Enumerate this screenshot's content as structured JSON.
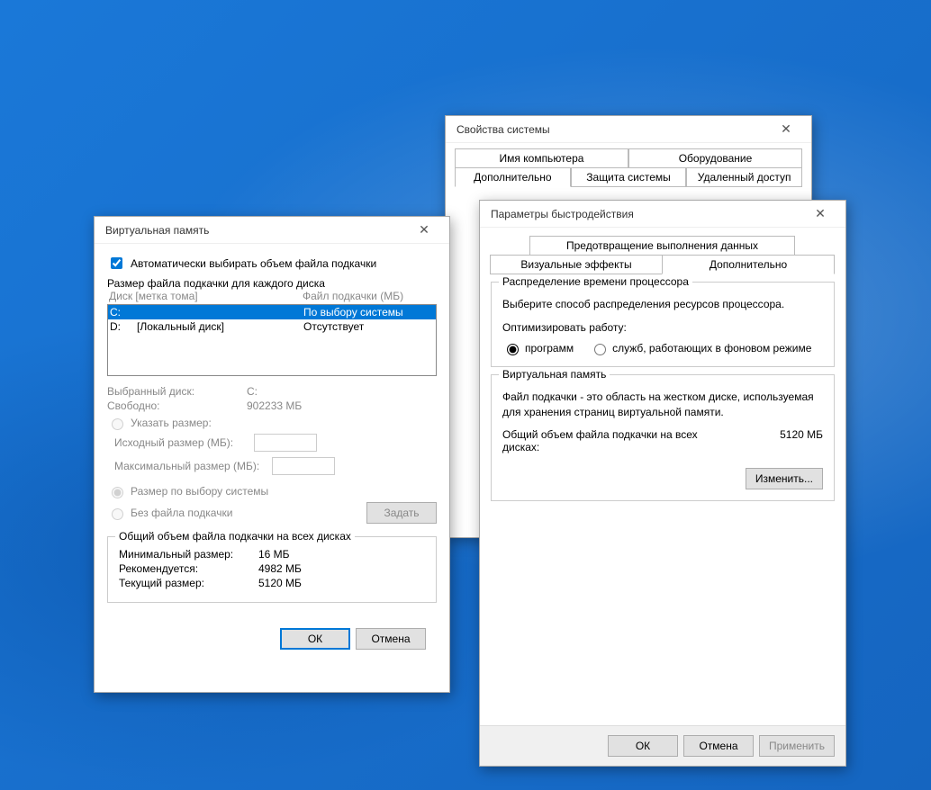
{
  "sys": {
    "title": "Свойства системы",
    "tabs": {
      "name": "Имя компьютера",
      "hardware": "Оборудование",
      "advanced": "Дополнительно",
      "protection": "Защита системы",
      "remote": "Удаленный доступ"
    }
  },
  "perf": {
    "title": "Параметры быстродействия",
    "tabs": {
      "dep": "Предотвращение выполнения данных",
      "visual": "Визуальные эффекты",
      "advanced": "Дополнительно"
    },
    "cpu": {
      "legend": "Распределение времени процессора",
      "desc": "Выберите способ распределения ресурсов процессора.",
      "optimize": "Оптимизировать работу:",
      "programs": "программ",
      "services": "служб, работающих в фоновом режиме"
    },
    "vm": {
      "legend": "Виртуальная память",
      "desc": "Файл подкачки - это область на жестком диске, используемая для хранения страниц виртуальной памяти.",
      "total_label": "Общий объем файла подкачки на всех дисках:",
      "total_value": "5120 МБ",
      "change": "Изменить..."
    },
    "buttons": {
      "ok": "ОК",
      "cancel": "Отмена",
      "apply": "Применить"
    }
  },
  "vm": {
    "title": "Виртуальная память",
    "auto": "Автоматически выбирать объем файла подкачки",
    "per_drive_label": "Размер файла подкачки для каждого диска",
    "headers": {
      "drive": "Диск [метка тома]",
      "file": "Файл подкачки (МБ)"
    },
    "rows": [
      {
        "drive": "C:",
        "label": "",
        "value": "По выбору системы",
        "selected": true
      },
      {
        "drive": "D:",
        "label": "[Локальный диск]",
        "value": "Отсутствует",
        "selected": false
      }
    ],
    "selected_drive_label": "Выбранный диск:",
    "selected_drive": "C:",
    "free_label": "Свободно:",
    "free_value": "902233 МБ",
    "custom_size": "Указать размер:",
    "initial": "Исходный размер (МБ):",
    "max": "Максимальный размер (МБ):",
    "system_managed": "Размер по выбору системы",
    "no_paging": "Без файла подкачки",
    "set_btn": "Задать",
    "totals": {
      "legend": "Общий объем файла подкачки на всех дисках",
      "min_label": "Минимальный размер:",
      "min": "16 МБ",
      "rec_label": "Рекомендуется:",
      "rec": "4982 МБ",
      "cur_label": "Текущий размер:",
      "cur": "5120 МБ"
    },
    "buttons": {
      "ok": "ОК",
      "cancel": "Отмена"
    }
  }
}
